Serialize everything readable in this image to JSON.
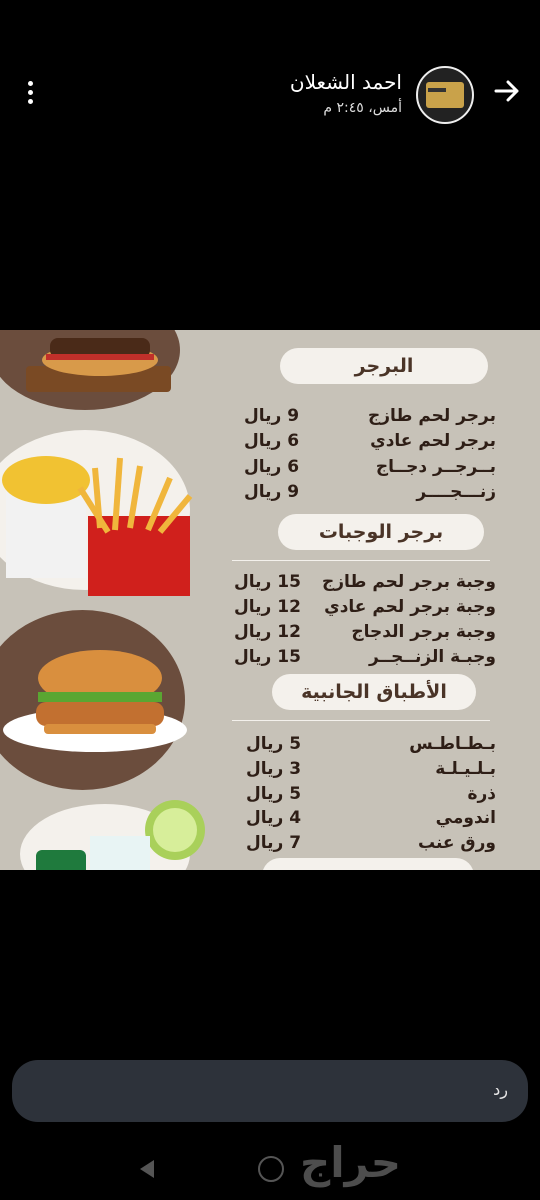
{
  "header": {
    "sender_name": "احمد الشعلان",
    "time": "أمس، ٢:٤٥ م"
  },
  "menu": {
    "sections": [
      {
        "title": "البرجر",
        "items": [
          {
            "name": "برجر لحم طازج",
            "price": "9 ريال"
          },
          {
            "name": "برجر لحم عادي",
            "price": "6 ريال"
          },
          {
            "name": "بــرجــر دجــاج",
            "price": "6 ريال"
          },
          {
            "name": "زنـــجــــر",
            "price": "9 ريال"
          }
        ]
      },
      {
        "title": "برجر الوجبات",
        "items": [
          {
            "name": "وجبة برجر لحم طازج",
            "price": "15 ريال"
          },
          {
            "name": "وجبة برجر لحم عادي",
            "price": "12 ريال"
          },
          {
            "name": "وجبة برجر الدجاج",
            "price": "12 ريال"
          },
          {
            "name": "وجبـة الزنــجــر",
            "price": "15 ريال"
          }
        ]
      },
      {
        "title": "الأطباق الجانبية",
        "items": [
          {
            "name": "بـطـاطـس",
            "price": "5 ريال"
          },
          {
            "name": "بـلـيـلـة",
            "price": "3 ريال"
          },
          {
            "name": "ذرة",
            "price": "5 ريال"
          },
          {
            "name": "اندومي",
            "price": "4 ريال"
          },
          {
            "name": "ورق عنب",
            "price": "7 ريال"
          }
        ]
      }
    ]
  },
  "reply": {
    "label": "رد"
  },
  "watermark": {
    "text": "حراج"
  },
  "icons": {
    "back": "arrow-right-icon",
    "more": "more-vertical-icon"
  },
  "colors": {
    "background": "#000000",
    "menu_bg": "#c7c2b8",
    "accent_brown": "#6b4d3d",
    "reply_box": "#2d323a"
  }
}
